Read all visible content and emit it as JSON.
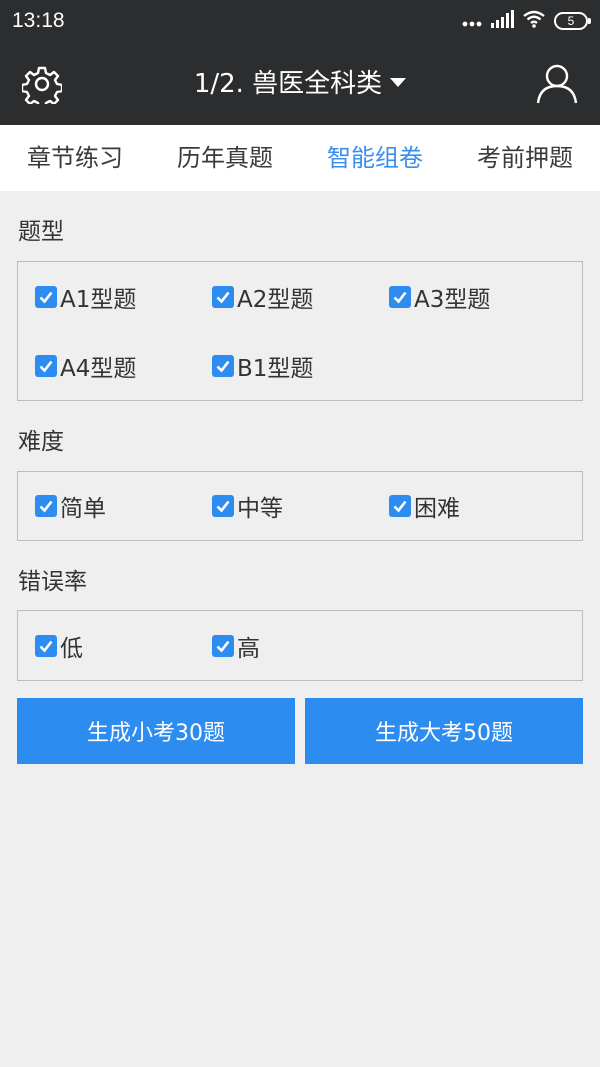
{
  "status": {
    "time": "13:18",
    "battery": "5"
  },
  "appbar": {
    "title": "1/2. 兽医全科类"
  },
  "tabs": [
    {
      "label": "章节练习"
    },
    {
      "label": "历年真题"
    },
    {
      "label": "智能组卷"
    },
    {
      "label": "考前押题"
    }
  ],
  "sections": {
    "type": {
      "title": "题型",
      "options": [
        {
          "label": "A1型题",
          "checked": true
        },
        {
          "label": "A2型题",
          "checked": true
        },
        {
          "label": "A3型题",
          "checked": true
        },
        {
          "label": "A4型题",
          "checked": true
        },
        {
          "label": "B1型题",
          "checked": true
        }
      ]
    },
    "difficulty": {
      "title": "难度",
      "options": [
        {
          "label": "简单",
          "checked": true
        },
        {
          "label": "中等",
          "checked": true
        },
        {
          "label": "困难",
          "checked": true
        }
      ]
    },
    "error_rate": {
      "title": "错误率",
      "options": [
        {
          "label": "低",
          "checked": true
        },
        {
          "label": "高",
          "checked": true
        }
      ]
    }
  },
  "buttons": {
    "small_exam": "生成小考30题",
    "big_exam": "生成大考50题"
  },
  "colors": {
    "accent": "#2d8cf0",
    "active_tab": "#3a8ef0",
    "appbar": "#2b2d2f"
  }
}
